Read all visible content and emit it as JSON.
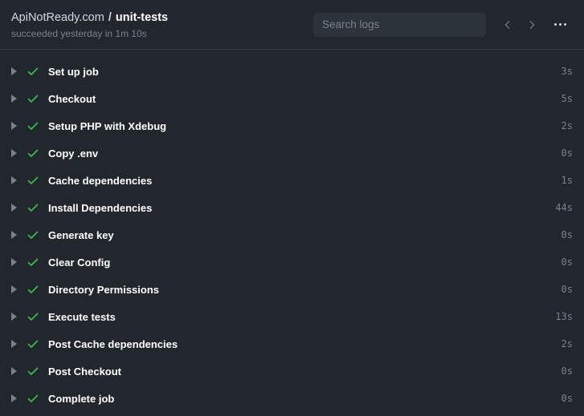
{
  "header": {
    "repo": "ApiNotReady.com",
    "separator": "/",
    "job_name": "unit-tests",
    "status_line": "succeeded yesterday in 1m 10s",
    "search": {
      "placeholder": "Search logs",
      "value": ""
    },
    "prev_label": "chevron-left-icon",
    "next_label": "chevron-right-icon",
    "menu_label": "kebab-menu-icon"
  },
  "colors": {
    "background": "#22272e",
    "header_border": "#373e47",
    "search_background": "#2d333b",
    "success_green": "#3fb950",
    "muted_text": "#768390",
    "label_text": "#ffffff"
  },
  "steps": [
    {
      "name": "Set up job",
      "duration": "3s",
      "status": "success"
    },
    {
      "name": "Checkout",
      "duration": "5s",
      "status": "success"
    },
    {
      "name": "Setup PHP with Xdebug",
      "duration": "2s",
      "status": "success"
    },
    {
      "name": "Copy .env",
      "duration": "0s",
      "status": "success"
    },
    {
      "name": "Cache dependencies",
      "duration": "1s",
      "status": "success"
    },
    {
      "name": "Install Dependencies",
      "duration": "44s",
      "status": "success"
    },
    {
      "name": "Generate key",
      "duration": "0s",
      "status": "success"
    },
    {
      "name": "Clear Config",
      "duration": "0s",
      "status": "success"
    },
    {
      "name": "Directory Permissions",
      "duration": "0s",
      "status": "success"
    },
    {
      "name": "Execute tests",
      "duration": "13s",
      "status": "success"
    },
    {
      "name": "Post Cache dependencies",
      "duration": "2s",
      "status": "success"
    },
    {
      "name": "Post Checkout",
      "duration": "0s",
      "status": "success"
    },
    {
      "name": "Complete job",
      "duration": "0s",
      "status": "success"
    }
  ]
}
